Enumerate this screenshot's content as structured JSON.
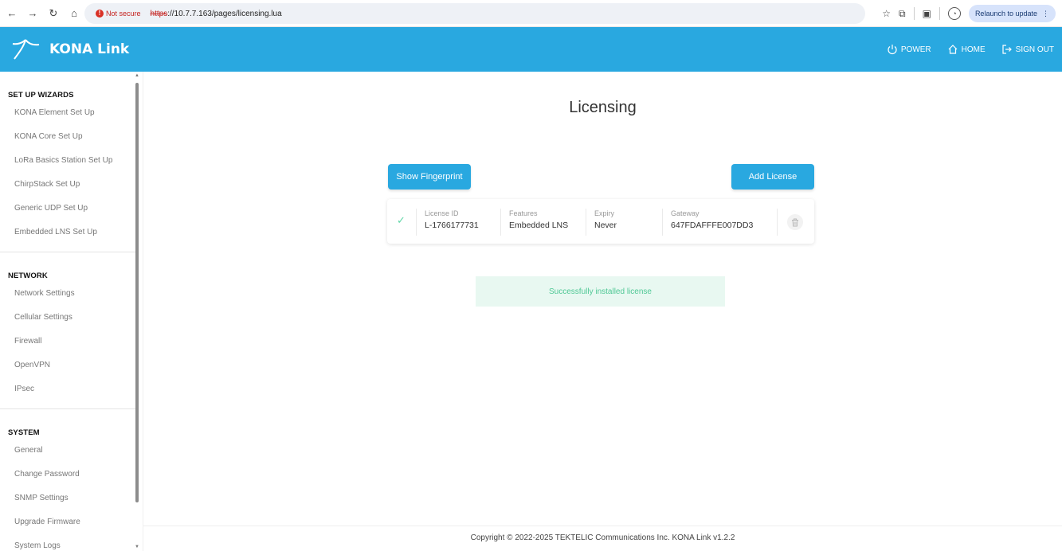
{
  "browser": {
    "not_secure_label": "Not secure",
    "url_scheme": "https",
    "url_rest": "://10.7.7.163/pages/licensing.lua",
    "relaunch_label": "Relaunch to update"
  },
  "header": {
    "brand": "KONA Link",
    "power_label": "POWER",
    "home_label": "HOME",
    "signout_label": "SIGN OUT",
    "accent_color": "#29a8e0"
  },
  "sidebar": {
    "sections": [
      {
        "title": "SET UP WIZARDS",
        "items": [
          "KONA Element Set Up",
          "KONA Core Set Up",
          "LoRa Basics Station Set Up",
          "ChirpStack Set Up",
          "Generic UDP Set Up",
          "Embedded LNS Set Up"
        ]
      },
      {
        "title": "NETWORK",
        "items": [
          "Network Settings",
          "Cellular Settings",
          "Firewall",
          "OpenVPN",
          "IPsec"
        ]
      },
      {
        "title": "SYSTEM",
        "items": [
          "General",
          "Change Password",
          "SNMP Settings",
          "Upgrade Firmware",
          "System Logs"
        ]
      }
    ]
  },
  "main": {
    "title": "Licensing",
    "show_fingerprint_label": "Show Fingerprint",
    "add_license_label": "Add License",
    "license": {
      "id_label": "License ID",
      "id_value": "L-1766177731",
      "features_label": "Features",
      "features_value": "Embedded LNS",
      "expiry_label": "Expiry",
      "expiry_value": "Never",
      "gateway_label": "Gateway",
      "gateway_value": "647FDAFFFE007DD3"
    },
    "success_message": "Successfully installed license",
    "success_color": "#4fc895"
  },
  "footer": {
    "text": "Copyright © 2022-2025 TEKTELIC Communications Inc. KONA Link v1.2.2"
  }
}
